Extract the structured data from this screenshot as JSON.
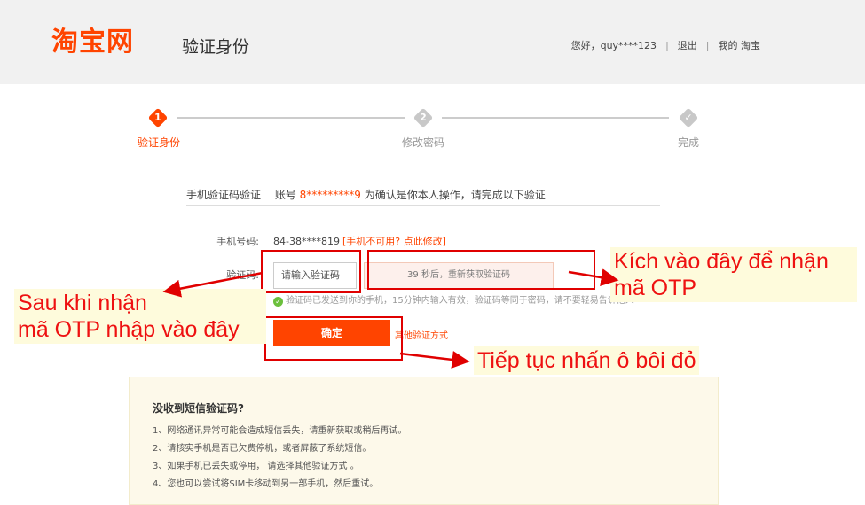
{
  "header": {
    "logo": "淘宝网",
    "title": "验证身份",
    "greeting": "您好，quy****123",
    "logout": "退出",
    "my_taobao": "我的 淘宝"
  },
  "steps": [
    {
      "number": "1",
      "label": "验证身份",
      "active": true
    },
    {
      "number": "2",
      "label": "修改密码",
      "active": false
    },
    {
      "number": "✓",
      "label": "完成",
      "active": false
    }
  ],
  "verify": {
    "heading_prefix": "手机验证码验证　 账号 ",
    "account": "8*********9",
    "heading_suffix": " 为确认是你本人操作，请完成以下验证"
  },
  "form": {
    "phone_label": "手机号码:",
    "phone_value": "84-38****819",
    "phone_unavailable_link": "[手机不可用? 点此修改]",
    "code_label": "验证码:",
    "code_placeholder": "请输入验证码",
    "resend_label": "39 秒后，重新获取验证码",
    "hint": "验证码已发送到你的手机，15分钟内输入有效，验证码等同于密码，请不要轻易告诉他人",
    "confirm_label": "确定",
    "other_methods": "其他验证方式"
  },
  "annotations": {
    "left_line1": "Sau khi nhận",
    "left_line2": "mã OTP nhập vào đây",
    "right_line1": "Kích vào đây để nhận",
    "right_line2": "mã OTP",
    "bottom": "Tiếp tục nhấn ô bôi đỏ"
  },
  "help": {
    "title": "没收到短信验证码?",
    "items": [
      "1、网络通讯异常可能会造成短信丢失，请重新获取或稍后再试。",
      "2、请核实手机是否已欠费停机，或者屏蔽了系统短信。",
      "3、如果手机已丢失或停用， 请选择其他验证方式 。",
      "4、您也可以尝试将SIM卡移动到另一部手机，然后重试。"
    ]
  },
  "colors": {
    "brand": "#ff4400",
    "annotation_red": "#ee1111",
    "annotation_bg": "#fefbdc",
    "step_inactive": "#c8c8c8"
  }
}
